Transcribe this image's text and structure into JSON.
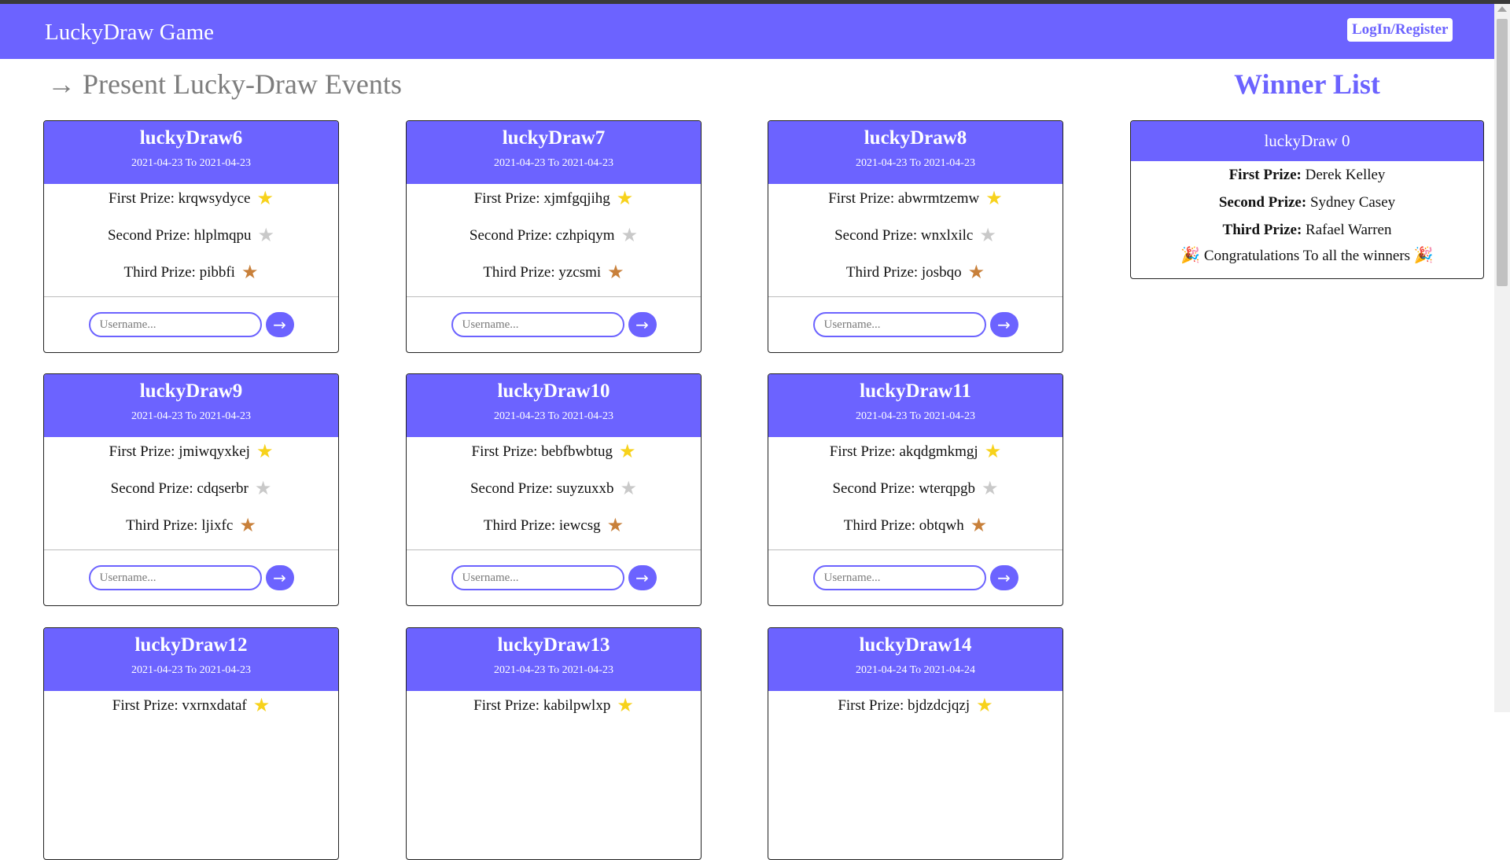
{
  "navbar": {
    "brand": "LuckyDraw Game",
    "login_label": "LogIn/Register"
  },
  "section_title": "→ Present Lucky-Draw Events",
  "winner_title": "Winner List",
  "input_placeholder": "Username...",
  "submit_arrow": "→",
  "prize_labels": {
    "first": "First Prize: ",
    "second": "Second Prize: ",
    "third": "Third Prize: "
  },
  "colors": {
    "accent": "#6c63ff",
    "gold_star": "#f7d21c",
    "silver_star": "#c9c9c9",
    "bronze_star": "#c8803a"
  },
  "events": [
    {
      "title": "luckyDraw6",
      "dates": "2021-04-23 To 2021-04-23",
      "first": "krqwsydyce",
      "second": "hlplmqpu",
      "third": "pibbfi"
    },
    {
      "title": "luckyDraw7",
      "dates": "2021-04-23 To 2021-04-23",
      "first": "xjmfgqjihg",
      "second": "czhpiqym",
      "third": "yzcsmi"
    },
    {
      "title": "luckyDraw8",
      "dates": "2021-04-23 To 2021-04-23",
      "first": "abwrmtzemw",
      "second": "wnxlxilc",
      "third": "josbqo"
    },
    {
      "title": "luckyDraw9",
      "dates": "2021-04-23 To 2021-04-23",
      "first": "jmiwqyxkej",
      "second": "cdqserbr",
      "third": "ljixfc"
    },
    {
      "title": "luckyDraw10",
      "dates": "2021-04-23 To 2021-04-23",
      "first": "bebfbwbtug",
      "second": "suyzuxxb",
      "third": "iewcsg"
    },
    {
      "title": "luckyDraw11",
      "dates": "2021-04-23 To 2021-04-23",
      "first": "akqdgmkmgj",
      "second": "wterqpgb",
      "third": "obtqwh"
    },
    {
      "title": "luckyDraw12",
      "dates": "2021-04-23 To 2021-04-23",
      "first": "vxrnxdataf",
      "second": "",
      "third": ""
    },
    {
      "title": "luckyDraw13",
      "dates": "2021-04-23 To 2021-04-23",
      "first": "kabilpwlxp",
      "second": "",
      "third": ""
    },
    {
      "title": "luckyDraw14",
      "dates": "2021-04-24 To 2021-04-24",
      "first": "bjdzdcjqzj",
      "second": "",
      "third": ""
    }
  ],
  "winner": {
    "event": "luckyDraw 0",
    "first_label": "First Prize:",
    "first": "Derek Kelley",
    "second_label": "Second Prize:",
    "second": "Sydney Casey",
    "third_label": "Third Prize:",
    "third": "Rafael Warren",
    "congrats": "Congratulations To all the winners",
    "party_icon": "🎉"
  }
}
